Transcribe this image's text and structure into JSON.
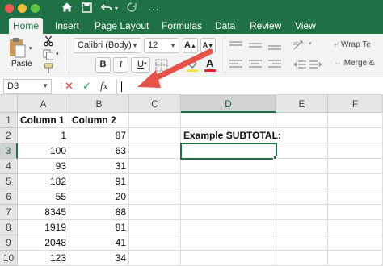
{
  "quick_access": {
    "home_icon": "home-icon",
    "save_icon": "save-icon",
    "undo_icon": "undo-icon",
    "redo_icon": "redo-icon",
    "more_icon": "more-icon"
  },
  "tabs": [
    {
      "label": "Home",
      "active": true
    },
    {
      "label": "Insert"
    },
    {
      "label": "Page Layout"
    },
    {
      "label": "Formulas"
    },
    {
      "label": "Data"
    },
    {
      "label": "Review"
    },
    {
      "label": "View"
    }
  ],
  "ribbon": {
    "paste_label": "Paste",
    "font_name": "Calibri (Body)",
    "font_size": "12",
    "bold": "B",
    "italic": "I",
    "underline": "U",
    "wrap_text": "Wrap Te",
    "merge": "Merge &",
    "grow_font": "A",
    "shrink_font": "A",
    "font_color": "A"
  },
  "formula_bar": {
    "name_box": "D3",
    "cancel_symbol": "✕",
    "enter_symbol": "✓",
    "fx_label": "fx",
    "content": ""
  },
  "columns": [
    "A",
    "B",
    "C",
    "D",
    "E",
    "F"
  ],
  "selected_column": "D",
  "selected_row": "3",
  "rows": [
    {
      "num": "1",
      "A": "Column 1",
      "B": "Column 2",
      "D": ""
    },
    {
      "num": "2",
      "A": "1",
      "B": "87",
      "D": "Example SUBTOTAL:"
    },
    {
      "num": "3",
      "A": "100",
      "B": "63",
      "D": ""
    },
    {
      "num": "4",
      "A": "93",
      "B": "31",
      "D": ""
    },
    {
      "num": "5",
      "A": "182",
      "B": "91",
      "D": ""
    },
    {
      "num": "6",
      "A": "55",
      "B": "20",
      "D": ""
    },
    {
      "num": "7",
      "A": "8345",
      "B": "88",
      "D": ""
    },
    {
      "num": "8",
      "A": "1919",
      "B": "81",
      "D": ""
    },
    {
      "num": "9",
      "A": "2048",
      "B": "41",
      "D": ""
    },
    {
      "num": "10",
      "A": "123",
      "B": "34",
      "D": ""
    }
  ],
  "colors": {
    "accent": "#1f7145",
    "arrow": "#e4524a"
  }
}
